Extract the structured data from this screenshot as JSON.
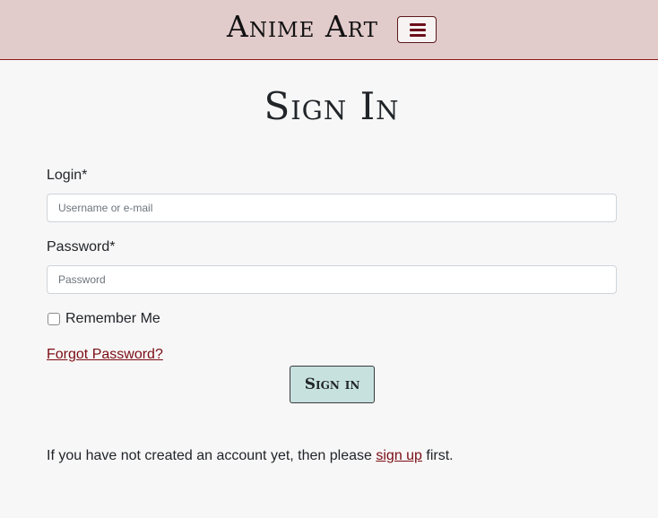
{
  "header": {
    "brand": "Anime Art",
    "menu_icon": "hamburger-menu-icon"
  },
  "page": {
    "title": "Sign In"
  },
  "form": {
    "login_label": "Login*",
    "login_placeholder": "Username or e-mail",
    "password_label": "Password*",
    "password_placeholder": "Password",
    "remember_label": "Remember Me",
    "remember_checked": false,
    "forgot_link": "Forgot Password?",
    "submit_label": "Sign in"
  },
  "footer_note": {
    "prefix": "If you have not created an account yet, then please ",
    "link": "sign up",
    "suffix": " first."
  },
  "colors": {
    "navbar_bg": "#e2cbcb",
    "link": "#7a0c14",
    "button_bg": "#c7e1df",
    "page_bg": "#f8f7f7"
  }
}
